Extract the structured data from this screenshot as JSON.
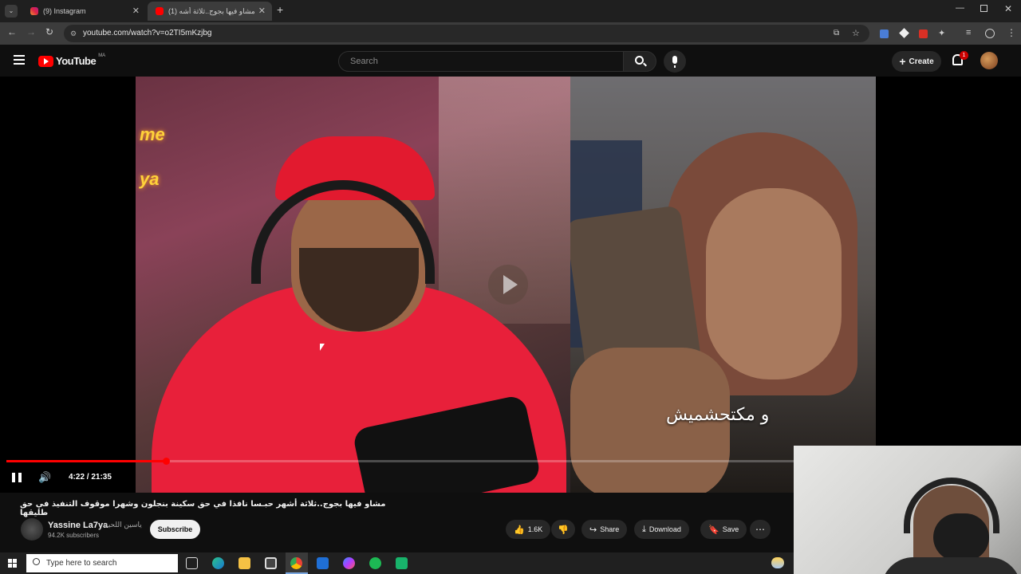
{
  "browser": {
    "tabs": [
      {
        "label": "(9) Instagram",
        "active": false
      },
      {
        "label": "(1) مشاو فيها بجوج..ثلاثة أشه",
        "active": true
      }
    ],
    "new_tab_icon": "plus-icon",
    "address": "youtube.com/watch?v=o2TI5mKzjbg"
  },
  "youtube": {
    "logo_text": "YouTube",
    "region": "MA",
    "search_placeholder": "Search",
    "create_label": "Create",
    "notification_count": "1"
  },
  "video": {
    "caption": "و مكتحشميش",
    "current_time": "4:22",
    "duration": "21:35",
    "time_display": "4:22 / 21:35",
    "progress": 0.203,
    "title": "مشاو فيها بجوج..ثلاثة أشهر حبـسا نافذا في حق سكينة بنجلون وشهرا موقوف التنفيذ في حق طليقها",
    "channel": {
      "name": "Yassine La7ya",
      "name_ar": "ياسين اللحية",
      "subscribers": "94.2K subscribers"
    },
    "subscribe_label": "Subscribe",
    "likes": "1.6K",
    "share_label": "Share",
    "download_label": "Download",
    "save_label": "Save"
  },
  "taskbar": {
    "search_placeholder": "Type here to search"
  }
}
